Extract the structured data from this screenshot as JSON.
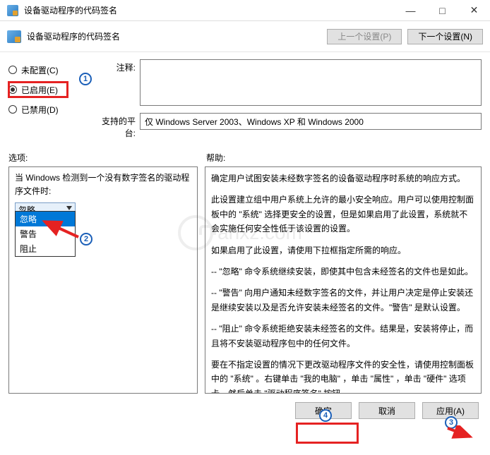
{
  "title": "设备驱动程序的代码签名",
  "subheader": {
    "title": "设备驱动程序的代码签名"
  },
  "nav": {
    "prev": "上一个设置(P)",
    "next": "下一个设置(N)"
  },
  "radios": {
    "unconfigured": "未配置(C)",
    "enabled": "已启用(E)",
    "disabled": "已禁用(D)",
    "selected": "enabled"
  },
  "fields": {
    "comment_label": "注释:",
    "platform_label": "支持的平台:",
    "platform_value": "仅 Windows Server 2003、Windows XP 和 Windows 2000"
  },
  "section_labels": {
    "options": "选项:",
    "help": "帮助:"
  },
  "options_pane": {
    "prompt": "当 Windows 检测到一个没有数字签名的驱动程序文件时:",
    "combo_selected": "忽略",
    "dropdown": [
      "忽略",
      "警告",
      "阻止"
    ]
  },
  "help_pane": {
    "p1": "确定用户试图安装未经数字签名的设备驱动程序时系统的响应方式。",
    "p2": "此设置建立组中用户系统上允许的最小安全响应。用户可以使用控制面板中的 \"系统\" 选择更安全的设置，但是如果启用了此设置，系统就不会实施任何安全性低于该设置的设置。",
    "p3": "如果启用了此设置，请使用下拉框指定所需的响应。",
    "p4": "-- \"忽略\" 命令系统继续安装，即使其中包含未经签名的文件也是如此。",
    "p5": "-- \"警告\" 向用户通知未经数字签名的文件，并让用户决定是停止安装还是继续安装以及是否允许安装未经签名的文件。\"警告\" 是默认设置。",
    "p6": "-- \"阻止\" 命令系统拒绝安装未经签名的文件。结果是，安装将停止，而且将不安装驱动程序包中的任何文件。",
    "p7": "要在不指定设置的情况下更改驱动程序文件的安全性，请使用控制面板中的 \"系统\" 。右键单击 \"我的电脑\" ，单击 \"属性\" ，单击 \"硬件\" 选项卡，然后单击 \"驱动程序签名\" 按钮。"
  },
  "buttons": {
    "ok": "确定",
    "cancel": "取消",
    "apply": "应用(A)"
  },
  "annotations": {
    "n1": "1",
    "n2": "2",
    "n3": "3",
    "n4": "4"
  },
  "watermark": "anxz.com"
}
